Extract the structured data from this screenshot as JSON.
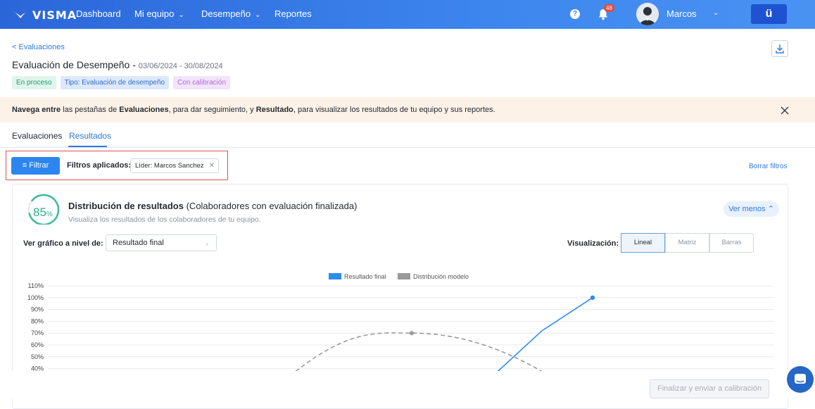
{
  "nav": {
    "logo": "VISMA",
    "items": [
      {
        "label": "Dashboard",
        "chevron": false
      },
      {
        "label": "Mi equipo",
        "chevron": true
      },
      {
        "label": "Desempeño",
        "chevron": true
      },
      {
        "label": "Reportes",
        "chevron": false
      }
    ],
    "help": "?",
    "notifications": "48",
    "user": "Marcos",
    "app_button": "ü"
  },
  "header": {
    "back": "< Evaluaciones",
    "title": "Evaluación de Desempeño",
    "separator": " - ",
    "dates": "03/06/2024 - 30/08/2024",
    "tags": [
      "En proceso",
      "Tipo: Evaluación de desempeño",
      "Con calibración"
    ]
  },
  "banner": {
    "b1": "Navega entre",
    "t1": " las pestañas de ",
    "b2": "Evaluaciones",
    "t2": ", para dar seguimiento, y ",
    "b3": "Resultado",
    "t3": ", para visualizar los resultados de tu equipo y sus reportes."
  },
  "tabs": [
    "Evaluaciones",
    "Resultados"
  ],
  "filters": {
    "button": "Filtrar",
    "label": "Filtros aplicados:",
    "chip": "Líder: Marcos Sanchez",
    "clear": "Borrar filtros"
  },
  "card": {
    "gauge_value": "85",
    "gauge_unit": "%",
    "gauge_fraction": 0.85,
    "title_bold": "Distribución de resultados",
    "title_rest": " (Colaboradores con evaluación finalizada)",
    "subtitle": "Visualiza los resultados de los colaboradores de tu equipo.",
    "toggle": "Ver menos",
    "level_label": "Ver gráfico a nivel de:",
    "level_value": "Resultado final",
    "viz_label": "Visualización:",
    "viz_options": [
      "Lineal",
      "Matriz",
      "Barras"
    ]
  },
  "chart_data": {
    "type": "line",
    "legend": [
      "Resultado final",
      "Distribución modelo"
    ],
    "y_ticks": [
      "110%",
      "100%",
      "90%",
      "80%",
      "70%",
      "60%",
      "50%",
      "40%"
    ],
    "ylim": [
      40,
      110
    ],
    "series": [
      {
        "name": "Resultado final",
        "color": "#2d8cf0",
        "style": "solid"
      },
      {
        "name": "Distribución modelo",
        "color": "#9a9a9a",
        "style": "dashed"
      }
    ],
    "colors": {
      "result": "#2d8cf0",
      "model": "#9a9a9a"
    }
  },
  "footer": {
    "finalize": "Finalizar y enviar a calibración"
  }
}
